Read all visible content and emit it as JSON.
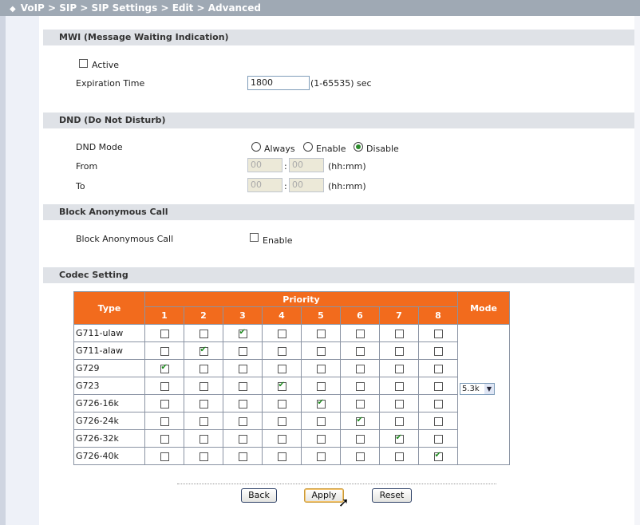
{
  "breadcrumb": "VoIP > SIP > SIP Settings > Edit > Advanced",
  "mwi": {
    "title": "MWI (Message Waiting Indication)",
    "active_label": "Active",
    "active_checked": false,
    "expiration_label": "Expiration Time",
    "expiration_value": "1800",
    "expiration_hint": "(1-65535) sec"
  },
  "dnd": {
    "title": "DND (Do Not Disturb)",
    "mode_label": "DND Mode",
    "options": [
      "Always",
      "Enable",
      "Disable"
    ],
    "selected": "Disable",
    "from_label": "From",
    "to_label": "To",
    "from_hh": "00",
    "from_mm": "00",
    "to_hh": "00",
    "to_mm": "00",
    "time_sep": ":",
    "time_hint": "(hh:mm)"
  },
  "block": {
    "title": "Block Anonymous Call",
    "label": "Block Anonymous Call",
    "enable_label": "Enable",
    "enabled": false
  },
  "codec": {
    "title": "Codec Setting",
    "type_header": "Type",
    "priority_header": "Priority",
    "mode_header": "Mode",
    "priorities": [
      "1",
      "2",
      "3",
      "4",
      "5",
      "6",
      "7",
      "8"
    ],
    "rows": [
      {
        "type": "G711-ulaw",
        "priority": 3
      },
      {
        "type": "G711-alaw",
        "priority": 2
      },
      {
        "type": "G729",
        "priority": 1
      },
      {
        "type": "G723",
        "priority": 4,
        "mode": "5.3k"
      },
      {
        "type": "G726-16k",
        "priority": 5
      },
      {
        "type": "G726-24k",
        "priority": 6
      },
      {
        "type": "G726-32k",
        "priority": 7
      },
      {
        "type": "G726-40k",
        "priority": 8
      }
    ]
  },
  "buttons": {
    "back": "Back",
    "apply": "Apply",
    "reset": "Reset"
  },
  "colors": {
    "header_orange": "#f26b1d",
    "check_green": "#1e8a1e",
    "section_bg": "#dfe2e7"
  }
}
